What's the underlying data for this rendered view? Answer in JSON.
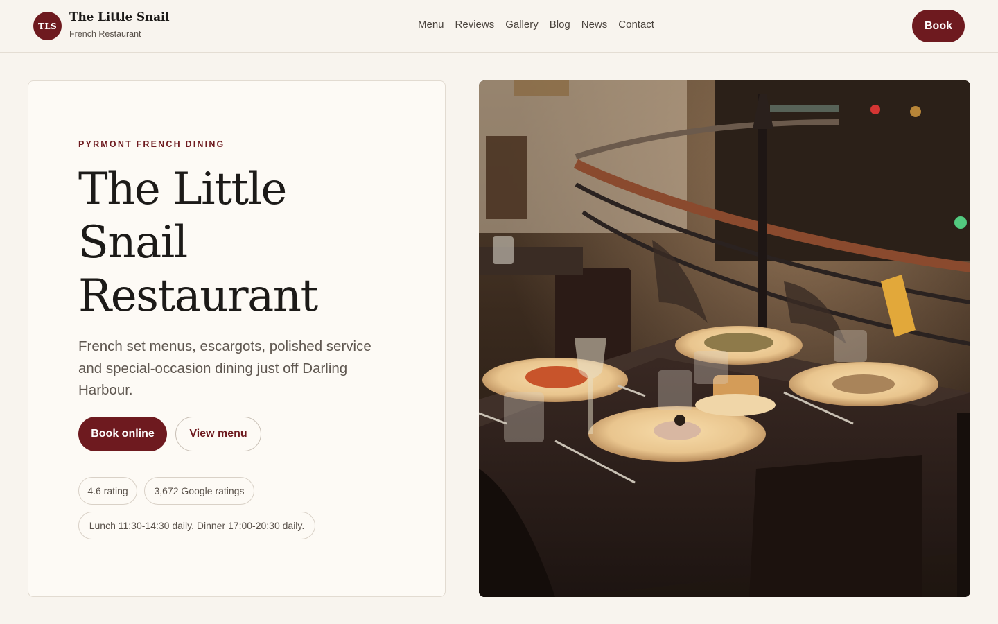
{
  "header": {
    "brand_initials": "TLS",
    "brand_name": "The Little Snail",
    "brand_subtitle": "French Restaurant",
    "nav": [
      "Menu",
      "Reviews",
      "Gallery",
      "Blog",
      "News",
      "Contact"
    ],
    "book_label": "Book"
  },
  "hero": {
    "eyebrow": "PYRMONT FRENCH DINING",
    "title": "The Little Snail Restaurant",
    "lead": "French set menus, escargots, polished service and special-occasion dining just off Darling Harbour.",
    "primary_cta": "Book online",
    "secondary_cta": "View menu",
    "chips": {
      "rating": "4.6 rating",
      "ratings_count": "3,672 Google ratings",
      "hours": "Lunch 11:30-14:30 daily. Dinner 17:00-20:30 daily."
    }
  },
  "photo": {
    "subject": "restaurant-table-photo"
  },
  "colors": {
    "accent": "#6e1a1f",
    "page_background": "#f8f4ee",
    "card_background": "#fdfaf5"
  }
}
